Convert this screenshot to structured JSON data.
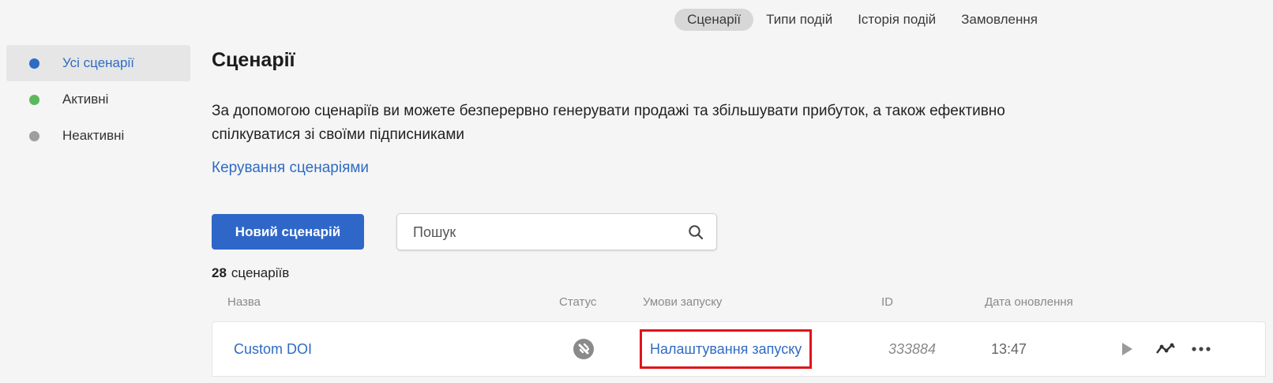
{
  "topnav": {
    "items": [
      {
        "label": "Сценарії",
        "active": true
      },
      {
        "label": "Типи подій",
        "active": false
      },
      {
        "label": "Історія подій",
        "active": false
      },
      {
        "label": "Замовлення",
        "active": false
      }
    ]
  },
  "sidebar": {
    "items": [
      {
        "label": "Усі сценарії",
        "dot_color": "#2f6bc4",
        "active": true
      },
      {
        "label": "Активні",
        "dot_color": "#5cb85c",
        "active": false
      },
      {
        "label": "Неактивні",
        "dot_color": "#9e9e9e",
        "active": false
      }
    ]
  },
  "main": {
    "title": "Сценарії",
    "description": "За допомогою сценаріїв ви можете безперервно генерувати продажі та збільшувати прибуток, а також ефективно спілкуватися зі своїми підписниками",
    "manage_link": "Керування сценаріями",
    "new_button": "Новий сценарій",
    "search_placeholder": "Пошук",
    "count_number": "28",
    "count_label": "сценаріїв"
  },
  "table": {
    "headers": {
      "name": "Назва",
      "status": "Статус",
      "trigger": "Умови запуску",
      "id": "ID",
      "updated": "Дата оновлення"
    },
    "rows": [
      {
        "name": "Custom DOI",
        "status_icon": "disabled-status-icon",
        "trigger": "Налаштування запуску",
        "id": "333884",
        "updated": "13:47",
        "actions": [
          "play-icon",
          "analytics-icon",
          "more-icon"
        ]
      }
    ]
  },
  "colors": {
    "accent": "#2f6bc4",
    "button": "#2f67c9",
    "highlight_box": "#e0141a"
  }
}
